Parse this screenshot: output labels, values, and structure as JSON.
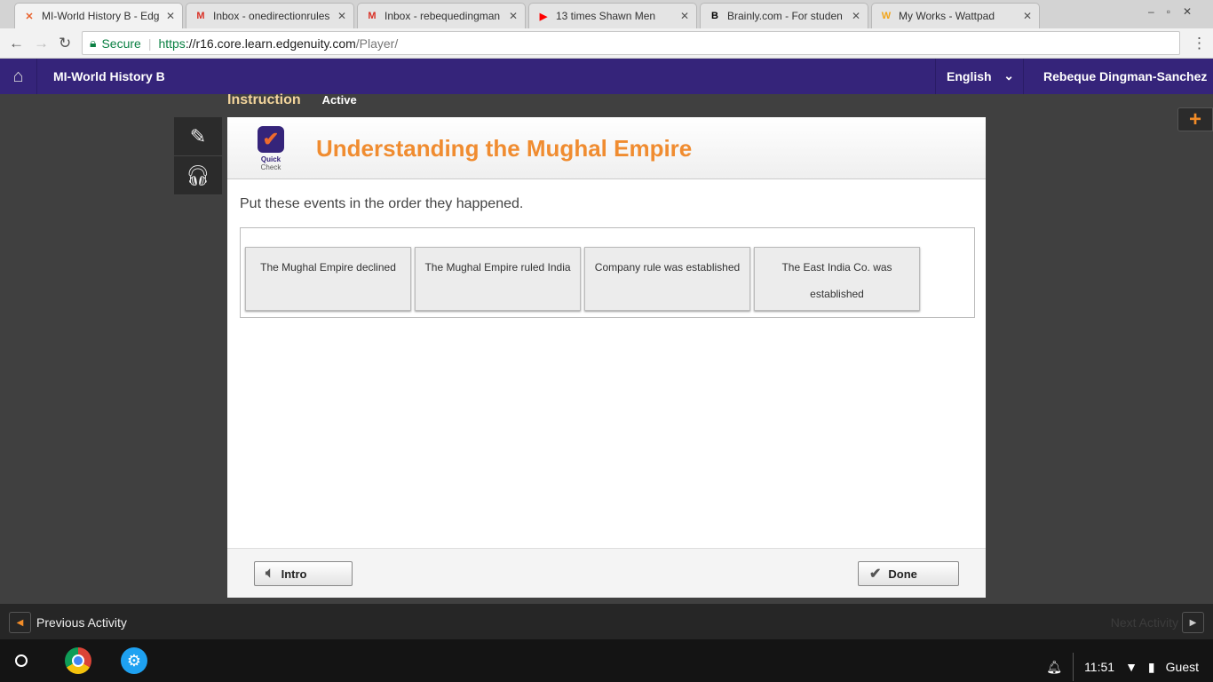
{
  "browser": {
    "tabs": [
      {
        "label": "MI-World History B - Edg",
        "icon": "edgenuity-icon",
        "color": "#e8612c",
        "active": true
      },
      {
        "label": "Inbox - onedirectionrules",
        "icon": "gmail-icon",
        "color": "#d93025"
      },
      {
        "label": "Inbox - rebequedingman",
        "icon": "gmail-icon",
        "color": "#d93025"
      },
      {
        "label": "13 times Shawn Men",
        "icon": "youtube-icon",
        "color": "#ff0000"
      },
      {
        "label": "Brainly.com - For studen",
        "icon": "brainly-icon",
        "color": "#000000"
      },
      {
        "label": "My Works - Wattpad",
        "icon": "wattpad-icon",
        "color": "#f2a417"
      }
    ],
    "secure": "Secure",
    "url_scheme": "https",
    "url_host": "://r16.core.learn.edgenuity.com",
    "url_path": "/Player/"
  },
  "app": {
    "course": "MI-World History B",
    "language": "English",
    "user": "Rebeque Dingman-Sanchez",
    "section": "Instruction",
    "status": "Active"
  },
  "activity": {
    "badge_line1": "Quick",
    "badge_line2": "Check",
    "title": "Understanding the Mughal Empire",
    "prompt": "Put these events in the order they happened.",
    "tiles": [
      "The Mughal Empire declined",
      "The Mughal Empire ruled India",
      "Company rule was established",
      "The East India Co. was established"
    ],
    "intro": "Intro",
    "done": "Done"
  },
  "nav": {
    "previous": "Previous Activity",
    "next": "Next Activity"
  },
  "shelf": {
    "time": "11:51",
    "user": "Guest"
  },
  "colors": {
    "brand": "#35247a",
    "accent": "#f08c30"
  }
}
